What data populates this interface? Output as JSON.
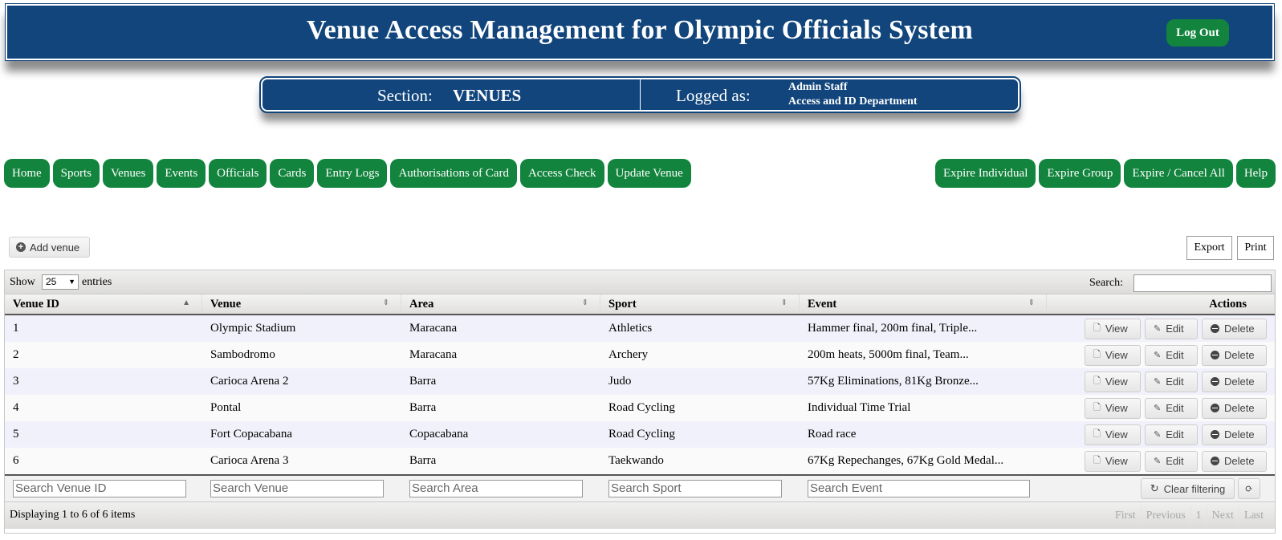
{
  "header": {
    "title": "Venue Access Management for Olympic Officials System",
    "logout_label": "Log Out"
  },
  "section": {
    "label": "Section:",
    "value": "VENUES",
    "logged_label": "Logged as:",
    "user_name": "Admin Staff",
    "user_dept": "Access and ID Department"
  },
  "nav_left": [
    "Home",
    "Sports",
    "Venues",
    "Events",
    "Officials",
    "Cards",
    "Entry Logs",
    "Authorisations of Card",
    "Access Check",
    "Update Venue"
  ],
  "nav_right": [
    "Expire Individual",
    "Expire Group",
    "Expire / Cancel All",
    "Help"
  ],
  "toolbar": {
    "add_label": "Add venue",
    "export_label": "Export",
    "print_label": "Print"
  },
  "grid": {
    "show_label": "Show",
    "page_size": "25",
    "entries_label": "entries",
    "search_label": "Search:",
    "columns": [
      "Venue ID",
      "Venue",
      "Area",
      "Sport",
      "Event",
      "Actions"
    ],
    "rows": [
      [
        "1",
        "Olympic Stadium",
        "Maracana",
        "Athletics",
        "Hammer final, 200m final, Triple..."
      ],
      [
        "2",
        "Sambodromo",
        "Maracana",
        "Archery",
        "200m heats, 5000m final, Team..."
      ],
      [
        "3",
        "Carioca Arena 2",
        "Barra",
        "Judo",
        "57Kg Eliminations, 81Kg Bronze..."
      ],
      [
        "4",
        "Pontal",
        "Barra",
        "Road Cycling",
        "Individual Time Trial"
      ],
      [
        "5",
        "Fort Copacabana",
        "Copacabana",
        "Road Cycling",
        "Road race"
      ],
      [
        "6",
        "Carioca Arena 3",
        "Barra",
        "Taekwando",
        "67Kg Repechanges, 67Kg Gold Medal..."
      ]
    ],
    "action_labels": {
      "view": "View",
      "edit": "Edit",
      "delete": "Delete"
    },
    "filter_placeholders": [
      "Search Venue ID",
      "Search Venue",
      "Search Area",
      "Search Sport",
      "Search Event"
    ],
    "clear_filter_label": "Clear filtering",
    "display_text": "Displaying 1 to 6 of 6 items",
    "pager": [
      "First",
      "Previous",
      "1",
      "Next",
      "Last"
    ]
  },
  "colors": {
    "header_bg": "#11457c",
    "button_green": "#12843d"
  }
}
